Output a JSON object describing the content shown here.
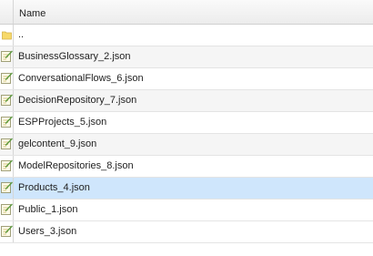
{
  "header": {
    "name_label": "Name"
  },
  "rows": [
    {
      "label": "..",
      "icon": "folder-icon"
    },
    {
      "label": "BusinessGlossary_2.json",
      "icon": "json-file-icon"
    },
    {
      "label": "ConversationalFlows_6.json",
      "icon": "json-file-icon"
    },
    {
      "label": "DecisionRepository_7.json",
      "icon": "json-file-icon"
    },
    {
      "label": "ESPProjects_5.json",
      "icon": "json-file-icon"
    },
    {
      "label": "gelcontent_9.json",
      "icon": "json-file-icon"
    },
    {
      "label": "ModelRepositories_8.json",
      "icon": "json-file-icon"
    },
    {
      "label": "Products_4.json",
      "icon": "json-file-icon",
      "selected": true
    },
    {
      "label": "Public_1.json",
      "icon": "json-file-icon"
    },
    {
      "label": "Users_3.json",
      "icon": "json-file-icon"
    }
  ],
  "colors": {
    "selection": "#cfe6fc",
    "folder": "#f7d96a",
    "file_accent": "#6fb34a"
  }
}
